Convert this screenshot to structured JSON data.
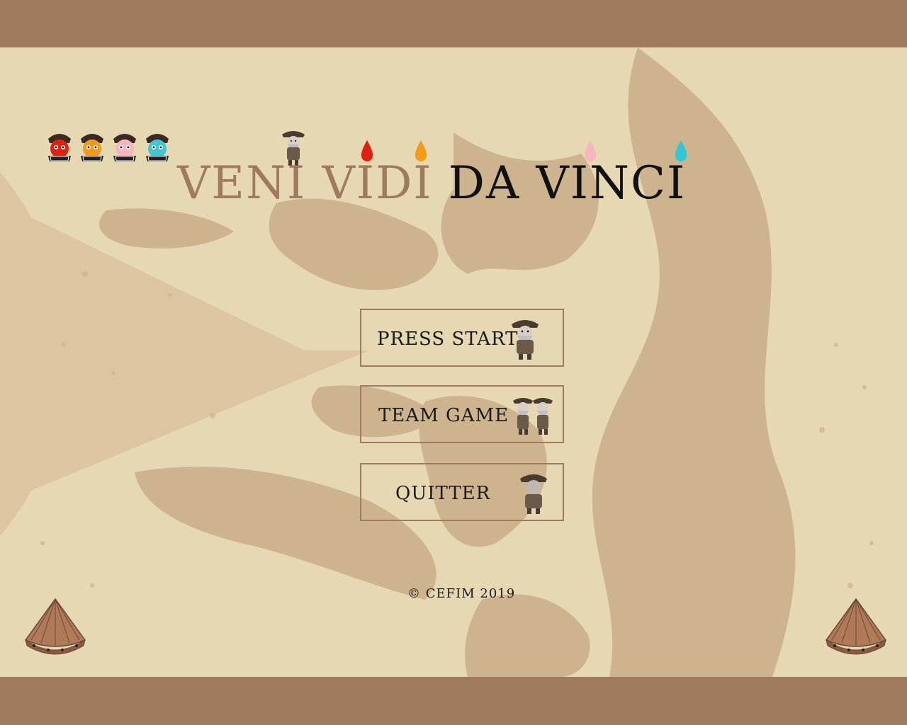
{
  "title": {
    "part1": "VENI VIDI",
    "part2": "DA VINCI"
  },
  "menu": {
    "start_label": "PRESS START",
    "team_label": "TEAM GAME",
    "quit_label": "QUITTER"
  },
  "footer": {
    "copyright": "© CEFIM  2019"
  },
  "lives": [
    {
      "icon": "red-ghost-icon",
      "color": "#e02010"
    },
    {
      "icon": "orange-ghost-icon",
      "color": "#f39a1a"
    },
    {
      "icon": "pink-ghost-icon",
      "color": "#f6b6c0"
    },
    {
      "icon": "cyan-ghost-icon",
      "color": "#40c8d0"
    }
  ],
  "drops": [
    {
      "icon": "red-paint-drop-icon",
      "color": "#e02010"
    },
    {
      "icon": "orange-paint-drop-icon",
      "color": "#f39a1a"
    },
    {
      "icon": "pink-paint-drop-icon",
      "color": "#f6b6c0"
    },
    {
      "icon": "cyan-paint-drop-icon",
      "color": "#30c8d6"
    }
  ],
  "colors": {
    "band": "#a07a5f",
    "background": "#e6d8b2",
    "pacman_shape": "#dcc5a0",
    "splatter": "#c9ad88",
    "title_light": "#a07a5f",
    "title_dark": "#111111"
  }
}
